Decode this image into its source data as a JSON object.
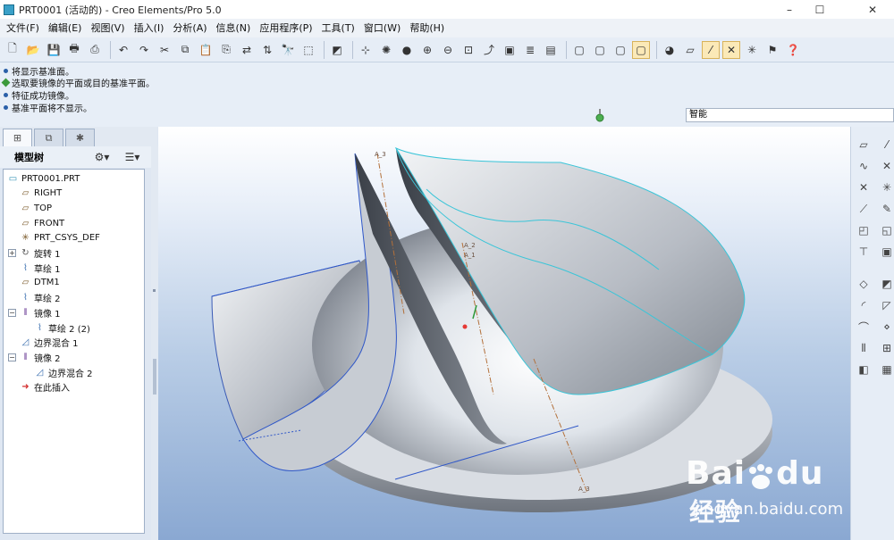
{
  "window": {
    "title": "PRT0001 (活动的) - Creo Elements/Pro 5.0",
    "controls": [
      "–",
      "☐",
      "✕"
    ]
  },
  "menu": [
    "文件(F)",
    "编辑(E)",
    "视图(V)",
    "插入(I)",
    "分析(A)",
    "信息(N)",
    "应用程序(P)",
    "工具(T)",
    "窗口(W)",
    "帮助(H)"
  ],
  "toolbar": {
    "buttons": [
      {
        "name": "new-icon",
        "glyph": "🗋"
      },
      {
        "name": "open-icon",
        "glyph": "📂"
      },
      {
        "name": "save-icon",
        "glyph": "💾"
      },
      {
        "name": "print-icon",
        "glyph": "🖶"
      },
      {
        "name": "send-icon",
        "glyph": "⎙"
      },
      {
        "name": "spacer",
        "glyph": ""
      },
      {
        "name": "undo-icon",
        "glyph": "↶"
      },
      {
        "name": "redo-icon",
        "glyph": "↷"
      },
      {
        "name": "cut-icon",
        "glyph": "✂"
      },
      {
        "name": "copy-icon",
        "glyph": "⧉"
      },
      {
        "name": "paste-icon",
        "glyph": "📋"
      },
      {
        "name": "paste-special-icon",
        "glyph": "⎘"
      },
      {
        "name": "regenerate-icon",
        "glyph": "⇄"
      },
      {
        "name": "regen-manager-icon",
        "glyph": "⇅"
      },
      {
        "name": "find-icon",
        "glyph": "🔭"
      },
      {
        "name": "select-box-icon",
        "glyph": "⬚"
      },
      {
        "name": "repaint-icon",
        "glyph": "◩"
      },
      {
        "name": "spin-center-icon",
        "glyph": "⊹"
      },
      {
        "name": "orient-mode-icon",
        "glyph": "✺"
      },
      {
        "name": "appearance-icon",
        "glyph": "●"
      },
      {
        "name": "zoom-in-icon",
        "glyph": "⊕"
      },
      {
        "name": "zoom-out-icon",
        "glyph": "⊖"
      },
      {
        "name": "refit-icon",
        "glyph": "⊡"
      },
      {
        "name": "reorient-icon",
        "glyph": "⤴"
      },
      {
        "name": "saved-views-icon",
        "glyph": "▣"
      },
      {
        "name": "layers-icon",
        "glyph": "≣"
      },
      {
        "name": "view-manager-icon",
        "glyph": "▤"
      },
      {
        "name": "wireframe-icon",
        "glyph": "▢"
      },
      {
        "name": "hidden-line-icon",
        "glyph": "▢"
      },
      {
        "name": "no-hidden-icon",
        "glyph": "▢"
      },
      {
        "name": "shading-icon",
        "glyph": "▢",
        "active": true
      },
      {
        "name": "enhanced-realism-icon",
        "glyph": "◕"
      },
      {
        "name": "datum-plane-display-icon",
        "glyph": "▱"
      },
      {
        "name": "datum-axis-display-icon",
        "glyph": "⁄",
        "active": true
      },
      {
        "name": "point-display-icon",
        "glyph": "✕",
        "active": true
      },
      {
        "name": "csys-display-icon",
        "glyph": "✳"
      },
      {
        "name": "annotation-display-icon",
        "glyph": "⚑"
      },
      {
        "name": "context-help-icon",
        "glyph": "❓"
      }
    ]
  },
  "messages": [
    {
      "type": "info",
      "text": "将显示基准面。"
    },
    {
      "type": "prompt",
      "text": "选取要镜像的平面或目的基准平面。"
    },
    {
      "type": "info",
      "text": "特征成功镜像。"
    },
    {
      "type": "info",
      "text": "基准平面将不显示。"
    }
  ],
  "filter": {
    "value": "智能"
  },
  "left_tabs": [
    {
      "name": "model-tree-tab",
      "glyph": "⊞",
      "active": true
    },
    {
      "name": "folder-browser-tab",
      "glyph": "⧉"
    },
    {
      "name": "favorites-tab",
      "glyph": "✱"
    }
  ],
  "model_tree": {
    "title": "模型树",
    "settings_glyph": "⚙▾",
    "show_glyph": "☰▾",
    "items": [
      {
        "label": "PRT0001.PRT",
        "icon": "part-icon",
        "glyph": "▭",
        "level": 0
      },
      {
        "label": "RIGHT",
        "icon": "datum-plane-icon",
        "glyph": "▱",
        "level": 1
      },
      {
        "label": "TOP",
        "icon": "datum-plane-icon",
        "glyph": "▱",
        "level": 1
      },
      {
        "label": "FRONT",
        "icon": "datum-plane-icon",
        "glyph": "▱",
        "level": 1
      },
      {
        "label": "PRT_CSYS_DEF",
        "icon": "csys-icon",
        "glyph": "✳",
        "level": 1
      },
      {
        "label": "旋转 1",
        "icon": "revolve-icon",
        "glyph": "↻",
        "level": 1,
        "expandable": true
      },
      {
        "label": "草绘 1",
        "icon": "sketch-icon",
        "glyph": "⌇",
        "level": 1
      },
      {
        "label": "DTM1",
        "icon": "datum-plane-icon",
        "glyph": "▱",
        "level": 1
      },
      {
        "label": "草绘 2",
        "icon": "sketch-icon",
        "glyph": "⌇",
        "level": 1
      },
      {
        "label": "镜像 1",
        "icon": "mirror-icon",
        "glyph": "⫴",
        "level": 1,
        "expandable": true,
        "expanded": true
      },
      {
        "label": "草绘 2 (2)",
        "icon": "sketch-icon",
        "glyph": "⌇",
        "level": 2
      },
      {
        "label": "边界混合 1",
        "icon": "boundary-blend-icon",
        "glyph": "◿",
        "level": 1
      },
      {
        "label": "镜像 2",
        "icon": "mirror-icon",
        "glyph": "⫴",
        "level": 1,
        "expandable": true,
        "expanded": true
      },
      {
        "label": "边界混合 2",
        "icon": "boundary-blend-icon",
        "glyph": "◿",
        "level": 2
      },
      {
        "label": "在此插入",
        "icon": "insert-here-icon",
        "glyph": "➜",
        "level": 1
      }
    ]
  },
  "graphics": {
    "axis_labels": [
      "A_3",
      "A_2",
      "A_1",
      "A_3"
    ]
  },
  "right_toolbar": [
    {
      "name": "datum-plane-tool-icon",
      "glyph": "▱"
    },
    {
      "name": "datum-axis-tool-icon",
      "glyph": "⁄"
    },
    {
      "name": "datum-curve-tool-icon",
      "glyph": "∿"
    },
    {
      "name": "datum-point-tool-icon",
      "glyph": "✕"
    },
    {
      "name": "offset-point-icon",
      "glyph": "✕"
    },
    {
      "name": "csys-tool-icon",
      "glyph": "✳"
    },
    {
      "name": "analysis-feature-icon",
      "glyph": "⟋"
    },
    {
      "name": "sketch-tool-icon",
      "glyph": "✎"
    },
    {
      "name": "extrude-tool-icon",
      "glyph": "◰"
    },
    {
      "name": "revolve-tool-icon",
      "glyph": "◱"
    },
    {
      "name": "hole-tool-icon",
      "glyph": "⊤"
    },
    {
      "name": "shell-tool-icon",
      "glyph": "▣"
    },
    {
      "name": "rib-tool-icon",
      "glyph": "◇"
    },
    {
      "name": "draft-tool-icon",
      "glyph": "◩"
    },
    {
      "name": "round-tool-icon",
      "glyph": "◜"
    },
    {
      "name": "chamfer-tool-icon",
      "glyph": "◸"
    },
    {
      "name": "sweep-icon",
      "glyph": "⌒"
    },
    {
      "name": "blend-icon",
      "glyph": "⋄"
    },
    {
      "name": "mirror-tool-icon",
      "glyph": "⫴"
    },
    {
      "name": "merge-icon",
      "glyph": "⊞"
    },
    {
      "name": "trim-icon",
      "glyph": "◧"
    },
    {
      "name": "pattern-icon",
      "glyph": "▦"
    }
  ],
  "watermark": {
    "brand_a": "Bai",
    "brand_b": "du",
    "brand_cn": "经验",
    "url": "jingyan.baidu.com"
  }
}
